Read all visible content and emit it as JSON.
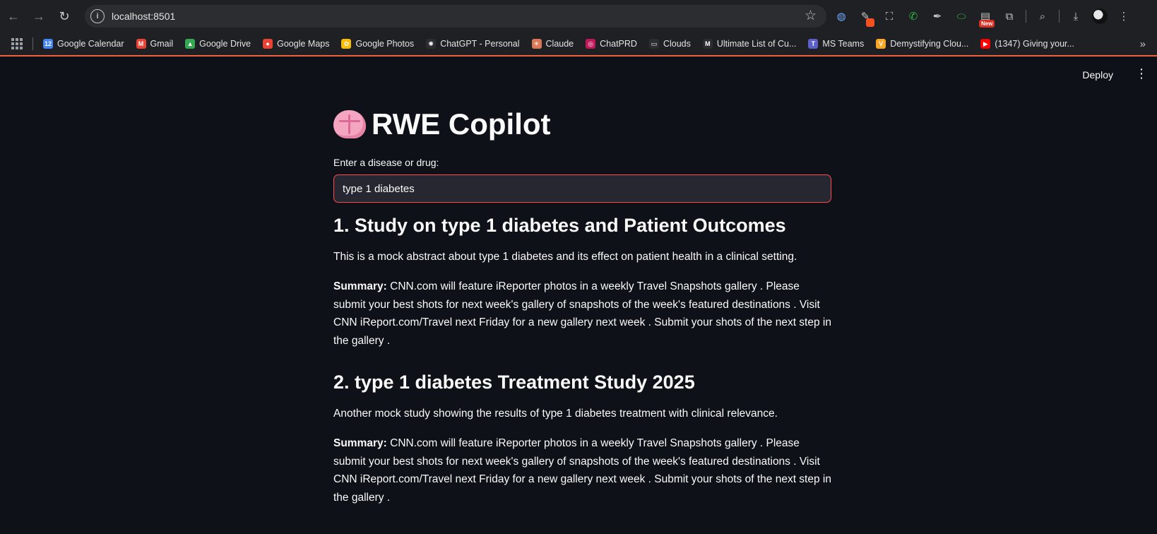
{
  "browser": {
    "url": "localhost:8501",
    "extension_new_badge": "New",
    "bookmarks": [
      {
        "label": "Google Calendar",
        "icon": "google-calendar-icon",
        "color": "#4285f4",
        "glyph": "12"
      },
      {
        "label": "Gmail",
        "icon": "gmail-icon",
        "color": "#ea4335",
        "glyph": "M"
      },
      {
        "label": "Google Drive",
        "icon": "google-drive-icon",
        "color": "#34a853",
        "glyph": "▲"
      },
      {
        "label": "Google Maps",
        "icon": "google-maps-icon",
        "color": "#ea4335",
        "glyph": "●"
      },
      {
        "label": "Google Photos",
        "icon": "google-photos-icon",
        "color": "#fbbc04",
        "glyph": "✿"
      },
      {
        "label": "ChatGPT - Personal",
        "icon": "chatgpt-icon",
        "color": "#2c2d30",
        "glyph": "✺"
      },
      {
        "label": "Claude",
        "icon": "claude-icon",
        "color": "#d97757",
        "glyph": "✳"
      },
      {
        "label": "ChatPRD",
        "icon": "chatprd-icon",
        "color": "#c2185b",
        "glyph": "◎"
      },
      {
        "label": "Clouds",
        "icon": "folder-icon",
        "color": "#2c2d30",
        "glyph": "▭"
      },
      {
        "label": "Ultimate List of Cu...",
        "icon": "medium-icon",
        "color": "#2c2d30",
        "glyph": "M"
      },
      {
        "label": "MS Teams",
        "icon": "ms-teams-icon",
        "color": "#5b5fc7",
        "glyph": "T"
      },
      {
        "label": "Demystifying Clou...",
        "icon": "v-icon",
        "color": "#f9a825",
        "glyph": "V"
      },
      {
        "label": "(1347) Giving your...",
        "icon": "youtube-icon",
        "color": "#ff0000",
        "glyph": "▶"
      }
    ]
  },
  "app": {
    "deploy_label": "Deploy",
    "title": "RWE Copilot",
    "input_label": "Enter a disease or drug:",
    "input_value": "type 1 diabetes",
    "summary_label": "Summary:",
    "results": [
      {
        "title": "1. Study on type 1 diabetes and Patient Outcomes",
        "abstract": "This is a mock abstract about type 1 diabetes and its effect on patient health in a clinical setting.",
        "summary": "CNN.com will feature iReporter photos in a weekly Travel Snapshots gallery . Please submit your best shots for next week's gallery of snapshots of the week's featured destinations . Visit CNN iReport.com/Travel next Friday for a new gallery next week . Submit your shots of the next step in the gallery ."
      },
      {
        "title": "2. type 1 diabetes Treatment Study 2025",
        "abstract": "Another mock study showing the results of type 1 diabetes treatment with clinical relevance.",
        "summary": "CNN.com will feature iReporter photos in a weekly Travel Snapshots gallery . Please submit your best shots for next week's gallery of snapshots of the week's featured destinations . Visit CNN iReport.com/Travel next Friday for a new gallery next week . Submit your shots of the next step in the gallery ."
      }
    ]
  }
}
